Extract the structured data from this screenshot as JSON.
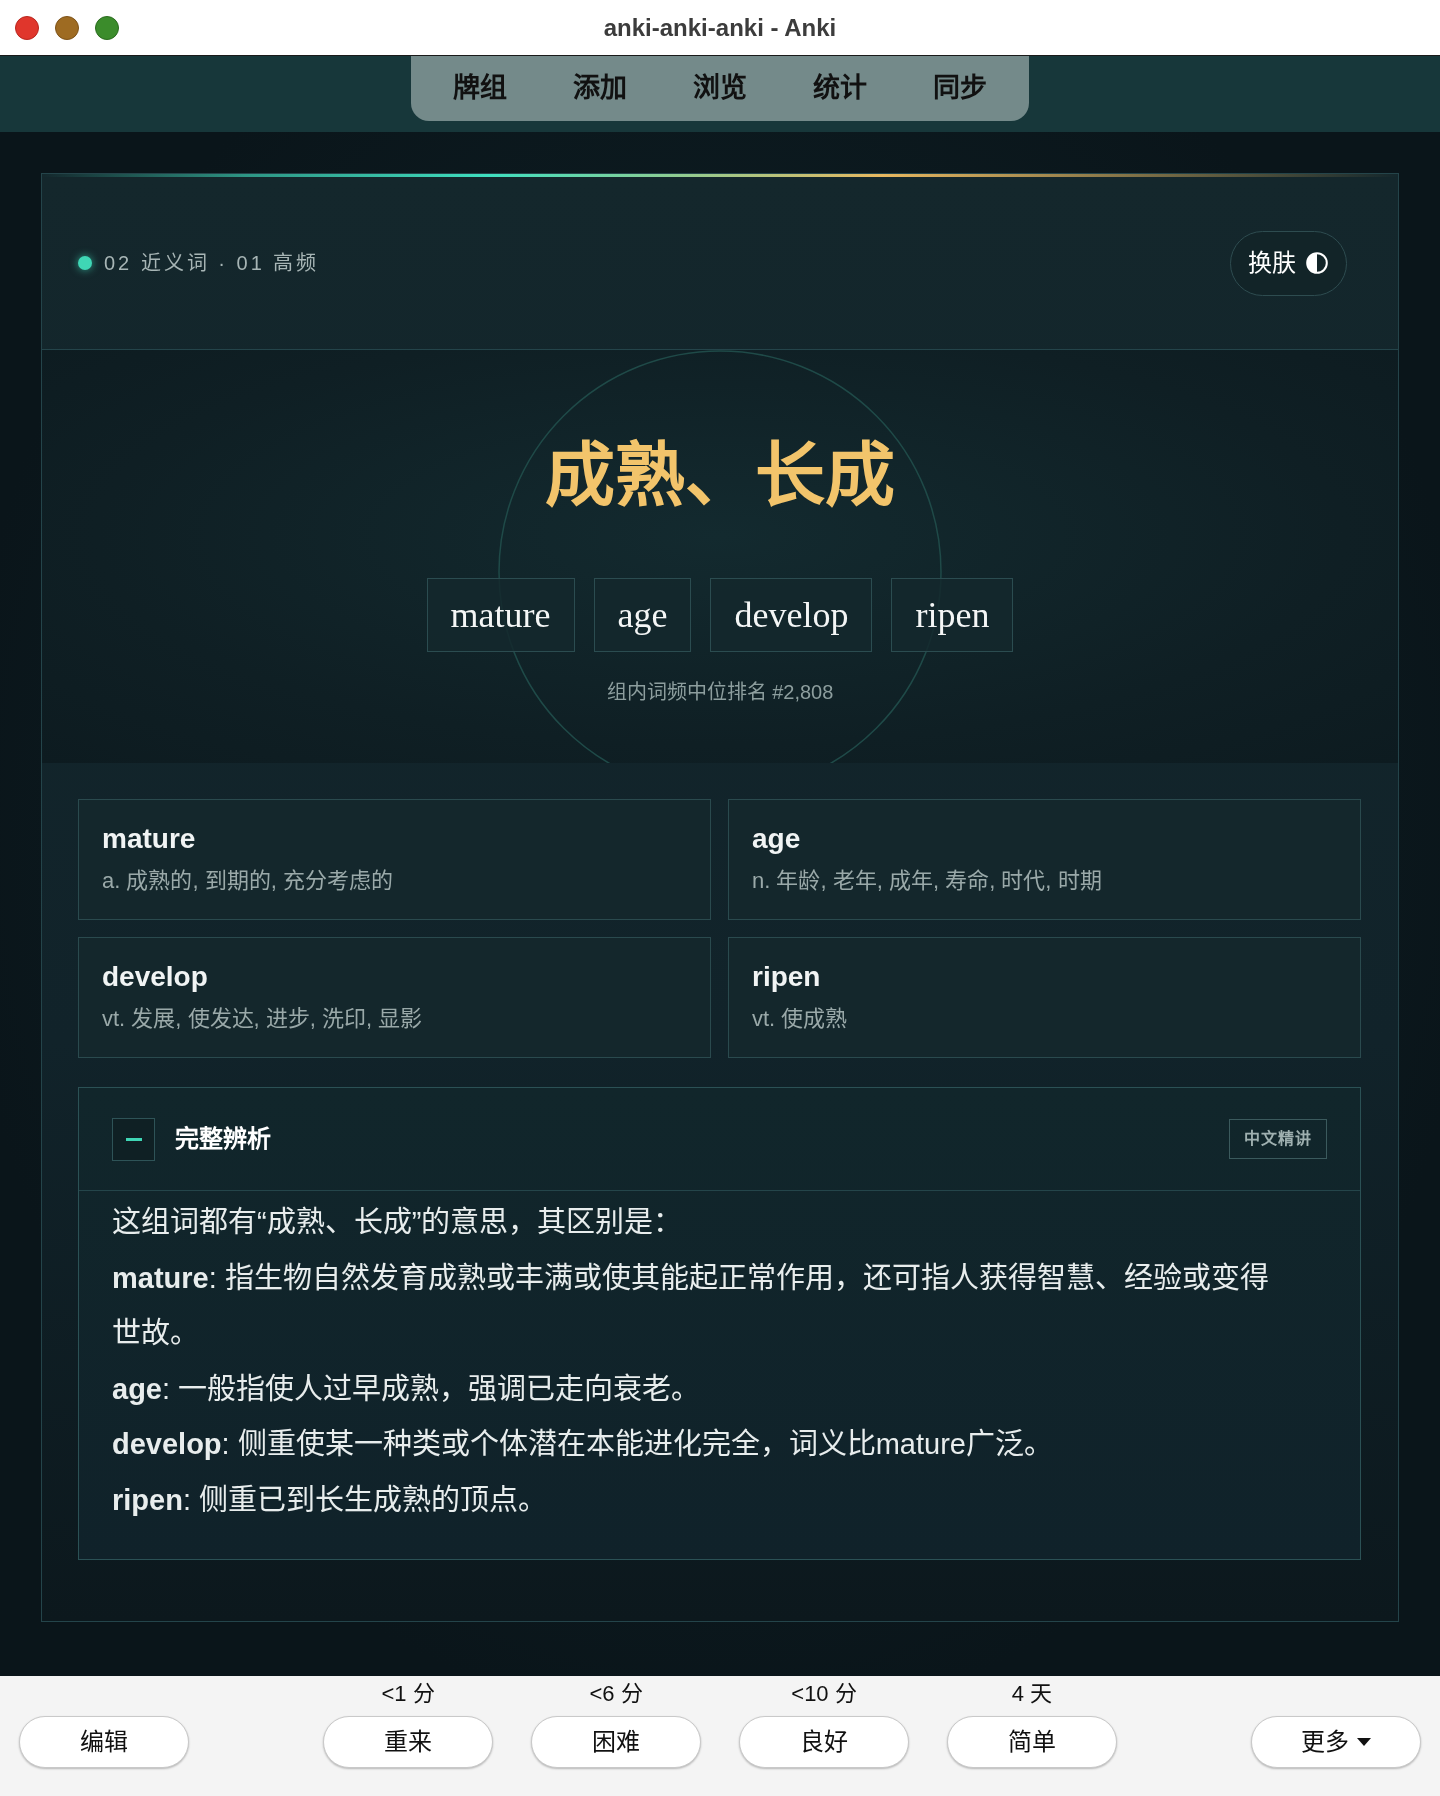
{
  "window": {
    "title": "anki-anki-anki - Anki"
  },
  "toolbar": {
    "links": [
      "牌组",
      "添加",
      "浏览",
      "统计",
      "同步"
    ]
  },
  "card": {
    "tag": "02 近义词 · 01 高频",
    "skin_button": "换肤",
    "hero": {
      "title": "成熟、长成",
      "words": [
        "mature",
        "age",
        "develop",
        "ripen"
      ],
      "rank": "组内词频中位排名 #2,808"
    },
    "definitions": [
      {
        "word": "mature",
        "meaning": "a. 成熟的, 到期的, 充分考虑的"
      },
      {
        "word": "age",
        "meaning": "n. 年龄, 老年, 成年, 寿命, 时代, 时期"
      },
      {
        "word": "develop",
        "meaning": "vt. 发展, 使发达, 进步, 洗印, 显影"
      },
      {
        "word": "ripen",
        "meaning": "vt. 使成熟"
      }
    ],
    "analysis": {
      "title": "完整辨析",
      "expanded": true,
      "badge": "中文精讲",
      "paragraphs": [
        "这组词都有“成熟、长成”的意思，其区别是：",
        "**mature**: 指生物自然发育成熟或丰满或使其能起正常作用，还可指人获得智慧、经验或变得世故。",
        "**age**: 一般指使人过早成熟，强调已走向衰老。",
        "**develop**: 侧重使某一种类或个体潜在本能进化完全，词义比mature广泛。",
        "**ripen**: 侧重已到长生成熟的顶点。"
      ]
    }
  },
  "answer_bar": {
    "edit_button": "编辑",
    "answers": [
      {
        "interval": "<1 分",
        "label": "重来"
      },
      {
        "interval": "<6 分",
        "label": "困难"
      },
      {
        "interval": "<10 分",
        "label": "良好"
      },
      {
        "interval": "4 天",
        "label": "简单"
      }
    ],
    "more_button": "更多"
  }
}
